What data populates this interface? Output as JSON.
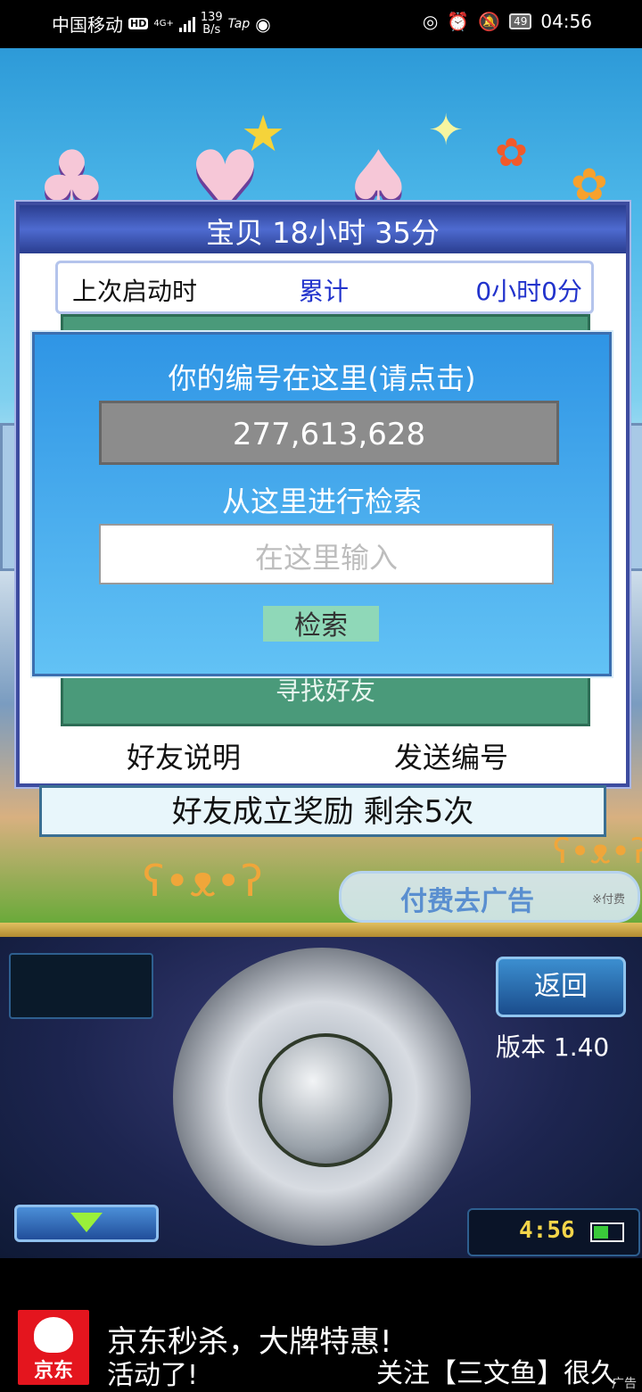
{
  "status_bar": {
    "carrier": "中国移动",
    "hd": "HD",
    "network": "4G+",
    "speed_value": "139",
    "speed_unit": "B/s",
    "app_tag": "Tap",
    "battery": "49",
    "time": "04:56"
  },
  "panel": {
    "title": "宝贝  18小时 35分",
    "row_label": "上次启动时",
    "row_mid": "累计",
    "row_value": "0小时0分",
    "find_friend": "寻找好友",
    "friend_help": "好友说明",
    "send_id": "发送编号",
    "reward": "好友成立奖励  剩余5次"
  },
  "dialog": {
    "title": "你的编号在这里(请点击)",
    "player_id": "277,613,628",
    "search_label": "从这里进行检索",
    "search_placeholder": "在这里输入",
    "search_button": "检索"
  },
  "pay_remove_ads": {
    "label": "付费去广告",
    "sub": "※付费"
  },
  "controller": {
    "back": "返回",
    "version": "版本 1.40",
    "clock": "4:56"
  },
  "ad": {
    "brand": "京东",
    "line1": "京东秒杀，大牌特惠!",
    "line2": "活动了!",
    "follow": "关注【三文鱼】很久",
    "tag": "广告"
  }
}
